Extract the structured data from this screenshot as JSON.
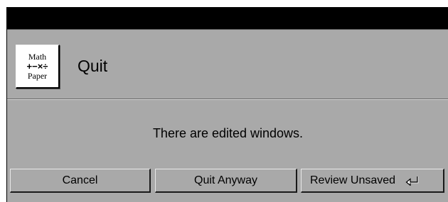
{
  "dialog": {
    "icon": {
      "name": "mathpaper-app-icon",
      "line1": "Math",
      "line2": "+−×÷",
      "line3": "Paper"
    },
    "title": "Quit",
    "message": "There are edited windows."
  },
  "buttons": {
    "cancel_label": "Cancel",
    "quit_anyway_label": "Quit Anyway",
    "review_unsaved_label": "Review Unsaved",
    "default_icon": "return-key-icon"
  },
  "colors": {
    "panel": "#a9a9a9",
    "titlebar": "#000000"
  }
}
